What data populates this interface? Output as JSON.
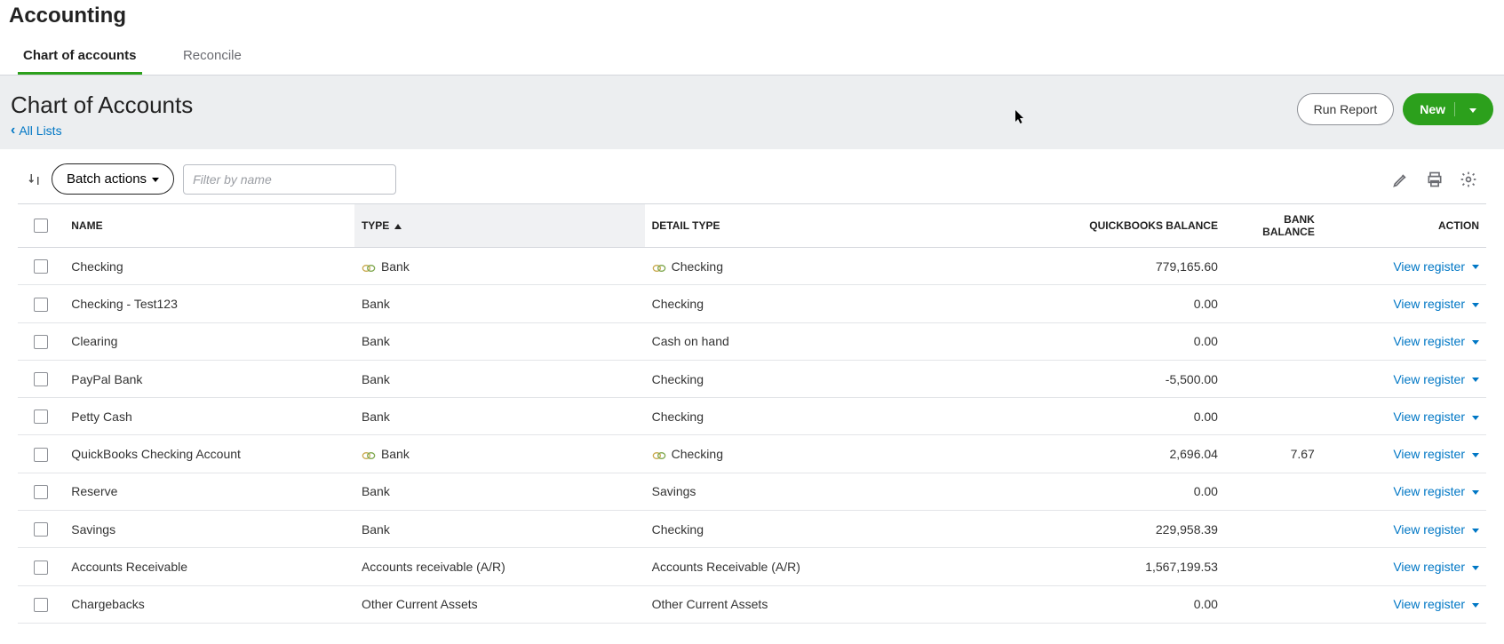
{
  "header": {
    "title": "Accounting"
  },
  "tabs": [
    {
      "label": "Chart of accounts",
      "active": true
    },
    {
      "label": "Reconcile",
      "active": false
    }
  ],
  "subhead": {
    "title": "Chart of Accounts",
    "back_label": "All Lists",
    "run_report_label": "Run Report",
    "new_label": "New"
  },
  "toolbar": {
    "batch_label": "Batch actions",
    "filter_placeholder": "Filter by name"
  },
  "columns": {
    "name": "NAME",
    "type": "TYPE",
    "detail_type": "DETAIL TYPE",
    "qb_balance": "QUICKBOOKS BALANCE",
    "bank_balance": "BANK BALANCE",
    "action": "ACTION"
  },
  "action_label": "View register",
  "rows": [
    {
      "name": "Checking",
      "type": "Bank",
      "type_linked": true,
      "detail_type": "Checking",
      "detail_linked": true,
      "qb_balance": "779,165.60",
      "bank_balance": ""
    },
    {
      "name": "Checking - Test123",
      "type": "Bank",
      "type_linked": false,
      "detail_type": "Checking",
      "detail_linked": false,
      "qb_balance": "0.00",
      "bank_balance": ""
    },
    {
      "name": "Clearing",
      "type": "Bank",
      "type_linked": false,
      "detail_type": "Cash on hand",
      "detail_linked": false,
      "qb_balance": "0.00",
      "bank_balance": ""
    },
    {
      "name": "PayPal Bank",
      "type": "Bank",
      "type_linked": false,
      "detail_type": "Checking",
      "detail_linked": false,
      "qb_balance": "-5,500.00",
      "bank_balance": ""
    },
    {
      "name": "Petty Cash",
      "type": "Bank",
      "type_linked": false,
      "detail_type": "Checking",
      "detail_linked": false,
      "qb_balance": "0.00",
      "bank_balance": ""
    },
    {
      "name": "QuickBooks Checking Account",
      "type": "Bank",
      "type_linked": true,
      "detail_type": "Checking",
      "detail_linked": true,
      "qb_balance": "2,696.04",
      "bank_balance": "7.67"
    },
    {
      "name": "Reserve",
      "type": "Bank",
      "type_linked": false,
      "detail_type": "Savings",
      "detail_linked": false,
      "qb_balance": "0.00",
      "bank_balance": ""
    },
    {
      "name": "Savings",
      "type": "Bank",
      "type_linked": false,
      "detail_type": "Checking",
      "detail_linked": false,
      "qb_balance": "229,958.39",
      "bank_balance": ""
    },
    {
      "name": "Accounts Receivable",
      "type": "Accounts receivable (A/R)",
      "type_linked": false,
      "detail_type": "Accounts Receivable (A/R)",
      "detail_linked": false,
      "qb_balance": "1,567,199.53",
      "bank_balance": ""
    },
    {
      "name": "Chargebacks",
      "type": "Other Current Assets",
      "type_linked": false,
      "detail_type": "Other Current Assets",
      "detail_linked": false,
      "qb_balance": "0.00",
      "bank_balance": ""
    }
  ]
}
